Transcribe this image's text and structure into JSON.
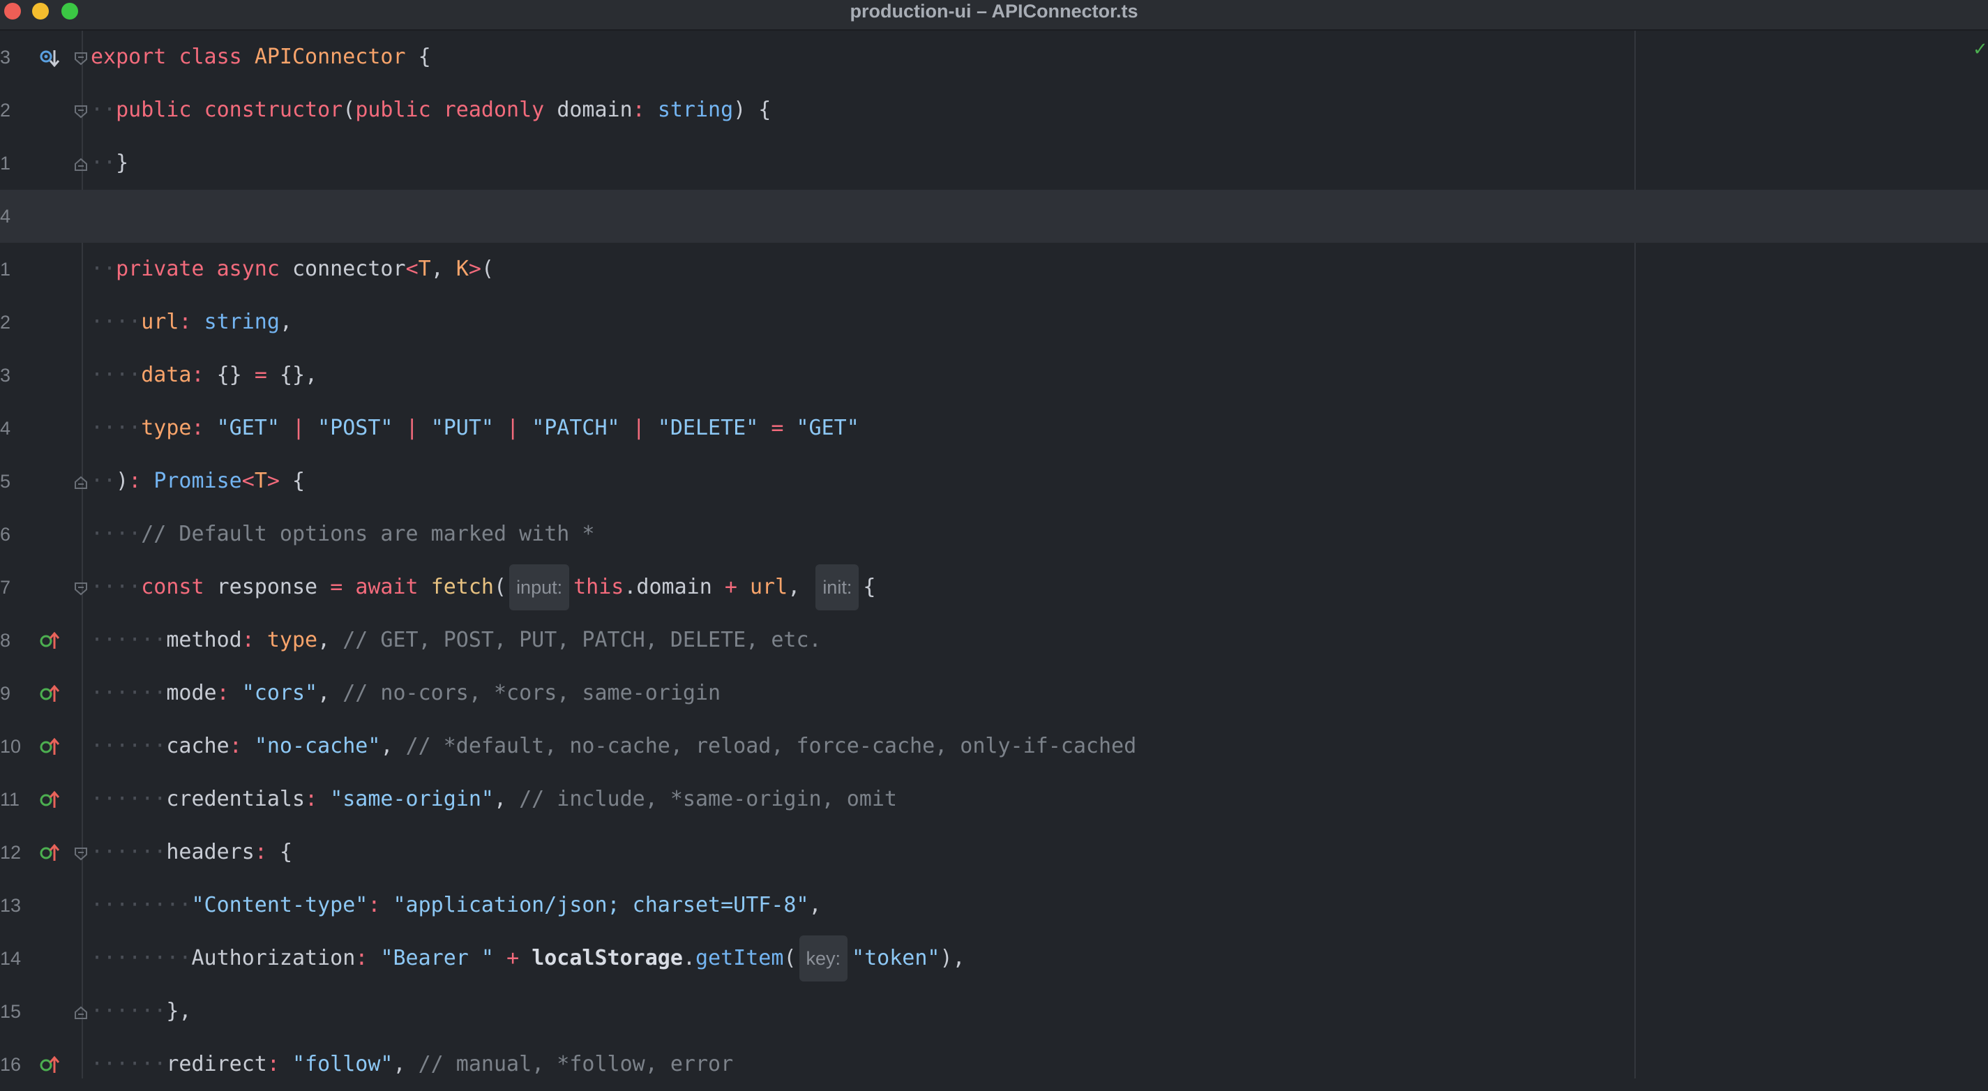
{
  "window": {
    "title": "production-ui – APIConnector.ts"
  },
  "editor": {
    "lines": [
      {
        "num": "3",
        "indent": "",
        "gicon": "bookmark-down",
        "fold": "open",
        "tokens": [
          {
            "t": "export ",
            "c": "kw"
          },
          {
            "t": "class ",
            "c": "kw"
          },
          {
            "t": "APIConnector",
            "c": "cls"
          },
          {
            "t": " {",
            "c": "pun"
          }
        ]
      },
      {
        "num": "2",
        "indent": "··",
        "fold": "open",
        "tokens": [
          {
            "t": "public ",
            "c": "kw"
          },
          {
            "t": "constructor",
            "c": "kw"
          },
          {
            "t": "(",
            "c": "pun"
          },
          {
            "t": "public ",
            "c": "kw"
          },
          {
            "t": "readonly ",
            "c": "kw"
          },
          {
            "t": "domain",
            "c": "plain"
          },
          {
            "t": ": ",
            "c": "op"
          },
          {
            "t": "string",
            "c": "type"
          },
          {
            "t": ") {",
            "c": "pun"
          }
        ]
      },
      {
        "num": "1",
        "indent": "··",
        "fold": "close",
        "tokens": [
          {
            "t": "}",
            "c": "pun"
          }
        ]
      },
      {
        "num": "4",
        "indent": "",
        "current": true,
        "tokens": []
      },
      {
        "num": "1",
        "indent": "··",
        "tokens": [
          {
            "t": "private ",
            "c": "kw"
          },
          {
            "t": "async ",
            "c": "kw"
          },
          {
            "t": "connector",
            "c": "plain"
          },
          {
            "t": "<",
            "c": "generic"
          },
          {
            "t": "T",
            "c": "cls"
          },
          {
            "t": ", ",
            "c": "pun"
          },
          {
            "t": "K",
            "c": "cls"
          },
          {
            "t": ">",
            "c": "generic"
          },
          {
            "t": "(",
            "c": "pun"
          }
        ]
      },
      {
        "num": "2",
        "indent": "····",
        "tokens": [
          {
            "t": "url",
            "c": "prop"
          },
          {
            "t": ": ",
            "c": "op"
          },
          {
            "t": "string",
            "c": "type"
          },
          {
            "t": ",",
            "c": "pun"
          }
        ]
      },
      {
        "num": "3",
        "indent": "····",
        "tokens": [
          {
            "t": "data",
            "c": "prop"
          },
          {
            "t": ": ",
            "c": "op"
          },
          {
            "t": "{} ",
            "c": "pun"
          },
          {
            "t": "= ",
            "c": "op"
          },
          {
            "t": "{},",
            "c": "pun"
          }
        ]
      },
      {
        "num": "4",
        "indent": "····",
        "tokens": [
          {
            "t": "type",
            "c": "prop"
          },
          {
            "t": ": ",
            "c": "op"
          },
          {
            "t": "\"GET\" ",
            "c": "str"
          },
          {
            "t": "| ",
            "c": "op"
          },
          {
            "t": "\"POST\" ",
            "c": "str"
          },
          {
            "t": "| ",
            "c": "op"
          },
          {
            "t": "\"PUT\" ",
            "c": "str"
          },
          {
            "t": "| ",
            "c": "op"
          },
          {
            "t": "\"PATCH\" ",
            "c": "str"
          },
          {
            "t": "| ",
            "c": "op"
          },
          {
            "t": "\"DELETE\" ",
            "c": "str"
          },
          {
            "t": "= ",
            "c": "op"
          },
          {
            "t": "\"GET\"",
            "c": "str"
          }
        ]
      },
      {
        "num": "5",
        "indent": "··",
        "fold": "close",
        "tokens": [
          {
            "t": ")",
            "c": "pun"
          },
          {
            "t": ": ",
            "c": "op"
          },
          {
            "t": "Promise",
            "c": "type"
          },
          {
            "t": "<",
            "c": "generic"
          },
          {
            "t": "T",
            "c": "cls"
          },
          {
            "t": ">",
            "c": "generic"
          },
          {
            "t": " {",
            "c": "pun"
          }
        ]
      },
      {
        "num": "6",
        "indent": "····",
        "tokens": [
          {
            "t": "// Default options are marked with *",
            "c": "cmt"
          }
        ]
      },
      {
        "num": "7",
        "indent": "····",
        "fold": "open",
        "tokens": [
          {
            "t": "const ",
            "c": "kw"
          },
          {
            "t": "response ",
            "c": "plain"
          },
          {
            "t": "= ",
            "c": "op"
          },
          {
            "t": "await ",
            "c": "kw"
          },
          {
            "t": "fetch",
            "c": "fn"
          },
          {
            "t": "(",
            "c": "pun"
          },
          {
            "hint": "input:"
          },
          {
            "t": "this",
            "c": "kw"
          },
          {
            "t": ".domain ",
            "c": "plain"
          },
          {
            "t": "+ ",
            "c": "op"
          },
          {
            "t": "url",
            "c": "prop"
          },
          {
            "t": ", ",
            "c": "pun"
          },
          {
            "hint": "init:"
          },
          {
            "t": "{",
            "c": "pun"
          }
        ]
      },
      {
        "num": "8",
        "indent": "······",
        "gicon": "override",
        "tokens": [
          {
            "t": "method",
            "c": "plain"
          },
          {
            "t": ": ",
            "c": "op"
          },
          {
            "t": "type",
            "c": "prop"
          },
          {
            "t": ", ",
            "c": "pun"
          },
          {
            "t": "// GET, POST, PUT, PATCH, DELETE, etc.",
            "c": "cmt"
          }
        ]
      },
      {
        "num": "9",
        "indent": "······",
        "gicon": "override",
        "tokens": [
          {
            "t": "mode",
            "c": "plain"
          },
          {
            "t": ": ",
            "c": "op"
          },
          {
            "t": "\"cors\"",
            "c": "str"
          },
          {
            "t": ", ",
            "c": "pun"
          },
          {
            "t": "// no-cors, *cors, same-origin",
            "c": "cmt"
          }
        ]
      },
      {
        "num": "10",
        "indent": "······",
        "gicon": "override",
        "tokens": [
          {
            "t": "cache",
            "c": "plain"
          },
          {
            "t": ": ",
            "c": "op"
          },
          {
            "t": "\"no-cache\"",
            "c": "str"
          },
          {
            "t": ", ",
            "c": "pun"
          },
          {
            "t": "// *default, no-cache, reload, force-cache, only-if-cached",
            "c": "cmt"
          }
        ]
      },
      {
        "num": "11",
        "indent": "······",
        "gicon": "override",
        "tokens": [
          {
            "t": "credentials",
            "c": "plain"
          },
          {
            "t": ": ",
            "c": "op"
          },
          {
            "t": "\"same-origin\"",
            "c": "str"
          },
          {
            "t": ", ",
            "c": "pun"
          },
          {
            "t": "// include, *same-origin, omit",
            "c": "cmt"
          }
        ]
      },
      {
        "num": "12",
        "indent": "······",
        "gicon": "override",
        "fold": "open",
        "tokens": [
          {
            "t": "headers",
            "c": "plain"
          },
          {
            "t": ": ",
            "c": "op"
          },
          {
            "t": "{",
            "c": "pun"
          }
        ]
      },
      {
        "num": "13",
        "indent": "········",
        "tokens": [
          {
            "t": "\"Content-type\"",
            "c": "str"
          },
          {
            "t": ": ",
            "c": "op"
          },
          {
            "t": "\"application/json; charset=UTF-8\"",
            "c": "str"
          },
          {
            "t": ",",
            "c": "pun"
          }
        ]
      },
      {
        "num": "14",
        "indent": "········",
        "tokens": [
          {
            "t": "Authorization",
            "c": "plain"
          },
          {
            "t": ": ",
            "c": "op"
          },
          {
            "t": "\"Bearer \" ",
            "c": "str"
          },
          {
            "t": "+ ",
            "c": "op"
          },
          {
            "t": "localStorage",
            "c": "bold"
          },
          {
            "t": ".",
            "c": "pun"
          },
          {
            "t": "getItem",
            "c": "type"
          },
          {
            "t": "(",
            "c": "pun"
          },
          {
            "hint": "key:"
          },
          {
            "t": "\"token\"",
            "c": "str"
          },
          {
            "t": "),",
            "c": "pun"
          }
        ]
      },
      {
        "num": "15",
        "indent": "······",
        "fold": "close",
        "tokens": [
          {
            "t": "},",
            "c": "pun"
          }
        ]
      },
      {
        "num": "16",
        "indent": "······",
        "gicon": "override",
        "tokens": [
          {
            "t": "redirect",
            "c": "plain"
          },
          {
            "t": ": ",
            "c": "op"
          },
          {
            "t": "\"follow\"",
            "c": "str"
          },
          {
            "t": ", ",
            "c": "pun"
          },
          {
            "t": "// manual, *follow, error",
            "c": "cmt"
          }
        ]
      }
    ]
  }
}
